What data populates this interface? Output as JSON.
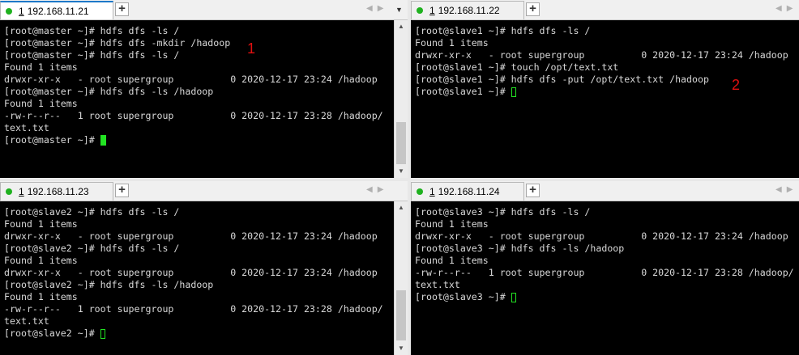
{
  "panes": [
    {
      "tab_number": "1",
      "tab_host": "192.168.11.21",
      "lines": [
        "[root@master ~]# hdfs dfs -ls /",
        "[root@master ~]# hdfs dfs -mkdir /hadoop",
        "[root@master ~]# hdfs dfs -ls /",
        "Found 1 items",
        "drwxr-xr-x   - root supergroup          0 2020-12-17 23:24 /hadoop",
        "[root@master ~]# hdfs dfs -ls /hadoop",
        "Found 1 items",
        "-rw-r--r--   1 root supergroup          0 2020-12-17 23:28 /hadoop/",
        "text.txt"
      ],
      "prompt": "[root@master ~]# "
    },
    {
      "tab_number": "1",
      "tab_host": "192.168.11.22",
      "lines": [
        "[root@slave1 ~]# hdfs dfs -ls /",
        "Found 1 items",
        "drwxr-xr-x   - root supergroup          0 2020-12-17 23:24 /hadoop",
        "[root@slave1 ~]# touch /opt/text.txt",
        "[root@slave1 ~]# hdfs dfs -put /opt/text.txt /hadoop"
      ],
      "prompt": "[root@slave1 ~]# "
    },
    {
      "tab_number": "1",
      "tab_host": "192.168.11.23",
      "lines": [
        "[root@slave2 ~]# hdfs dfs -ls /",
        "Found 1 items",
        "drwxr-xr-x   - root supergroup          0 2020-12-17 23:24 /hadoop",
        "[root@slave2 ~]# hdfs dfs -ls /",
        "Found 1 items",
        "drwxr-xr-x   - root supergroup          0 2020-12-17 23:24 /hadoop",
        "[root@slave2 ~]# hdfs dfs -ls /hadoop",
        "Found 1 items",
        "-rw-r--r--   1 root supergroup          0 2020-12-17 23:28 /hadoop/",
        "text.txt"
      ],
      "prompt": "[root@slave2 ~]# "
    },
    {
      "tab_number": "1",
      "tab_host": "192.168.11.24",
      "lines": [
        "[root@slave3 ~]# hdfs dfs -ls /",
        "Found 1 items",
        "drwxr-xr-x   - root supergroup          0 2020-12-17 23:24 /hadoop",
        "[root@slave3 ~]# hdfs dfs -ls /hadoop",
        "Found 1 items",
        "-rw-r--r--   1 root supergroup          0 2020-12-17 23:28 /hadoop/",
        "text.txt"
      ],
      "prompt": "[root@slave3 ~]# "
    }
  ],
  "annotations": [
    "1",
    "2"
  ],
  "colors": {
    "terminal_bg": "#000000",
    "terminal_text": "#d8d8d8",
    "cursor": "#22e322",
    "status_dot": "#1fb11f",
    "annotation": "#e01010",
    "active_tab_accent": "#1e78c8"
  },
  "icons": {
    "status": "connected-dot-icon",
    "new_tab": "plus-icon",
    "nav": "arrow-left-right-icon",
    "menu": "chevron-down-icon"
  }
}
